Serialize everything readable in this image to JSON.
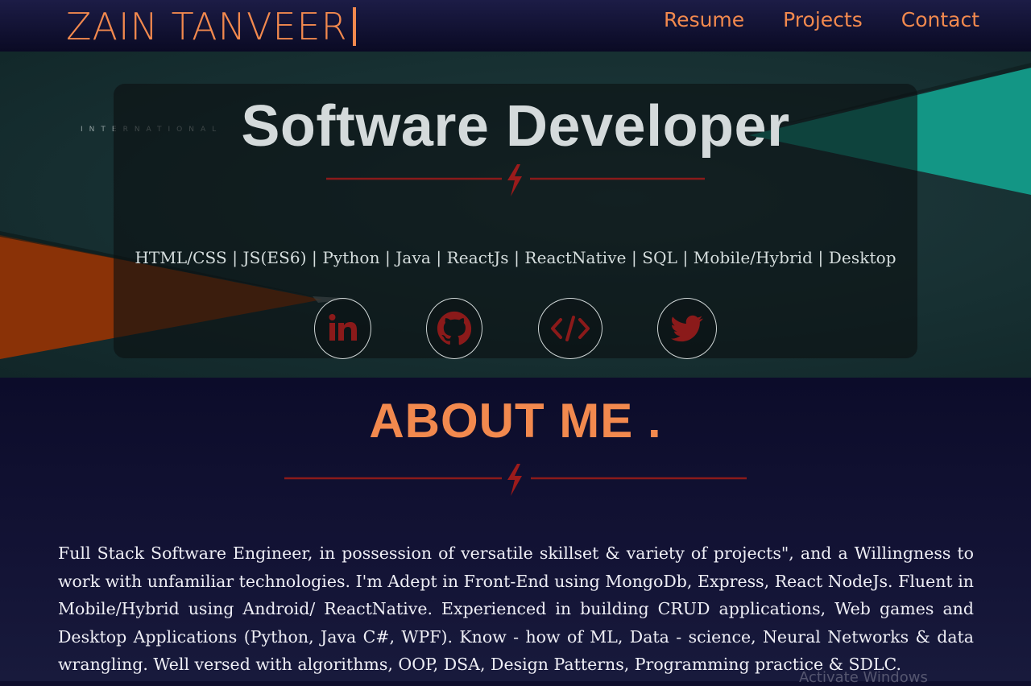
{
  "header": {
    "brand": "ZAIN TANVEER",
    "nav": [
      {
        "label": "Resume"
      },
      {
        "label": "Projects"
      },
      {
        "label": "Contact"
      }
    ]
  },
  "hero": {
    "background_text": "INTERNATIONAL",
    "title": "Software Developer",
    "skills": "HTML/CSS | JS(ES6) | Python | Java | ReactJs | ReactNative | SQL | Mobile/Hybrid | Desktop",
    "social": [
      {
        "icon": "linkedin-icon",
        "label": "in"
      },
      {
        "icon": "github-icon"
      },
      {
        "icon": "code-icon",
        "label": "</>"
      },
      {
        "icon": "twitter-icon"
      }
    ]
  },
  "about": {
    "title": "ABOUT ME .",
    "text": "Full Stack Software Engineer, in possession of versatile skillset & variety of projects\", and a Willingness to work with unfamiliar technologies. I'm Adept in Front-End using MongoDb, Express, React NodeJs. Fluent in Mobile/Hybrid using Android/ ReactNative. Experienced in building CRUD applications, Web games and Desktop Applications (Python, Java C#, WPF). Know - how of ML, Data - science, Neural Networks & data wrangling. Well versed with algorithms, OOP, DSA, Design Patterns, Programming practice & SDLC."
  },
  "overlay": {
    "watermark": "Activate Windows"
  },
  "colors": {
    "accent": "#f2894e",
    "divider": "#8b1a1a",
    "icon": "#8b1a1a"
  }
}
